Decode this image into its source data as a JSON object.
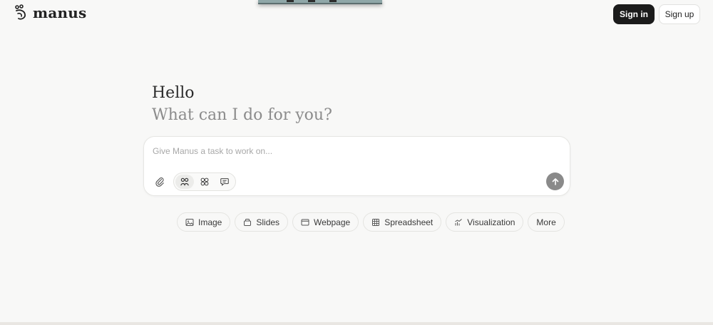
{
  "header": {
    "brand": "manus",
    "sign_in_label": "Sign in",
    "sign_up_label": "Sign up"
  },
  "greeting": {
    "title": "Hello",
    "subtitle": "What can I do for you?"
  },
  "composer": {
    "placeholder": "Give Manus a task to work on...",
    "value": ""
  },
  "chips": [
    {
      "label": "Image",
      "icon": "image-icon"
    },
    {
      "label": "Slides",
      "icon": "slides-icon"
    },
    {
      "label": "Webpage",
      "icon": "webpage-icon"
    },
    {
      "label": "Spreadsheet",
      "icon": "spreadsheet-icon"
    },
    {
      "label": "Visualization",
      "icon": "visualization-icon"
    },
    {
      "label": "More",
      "icon": ""
    }
  ],
  "colors": {
    "background": "#f8f8f7",
    "primary_button": "#1b1b1b",
    "send_button": "#8a8a8a"
  }
}
